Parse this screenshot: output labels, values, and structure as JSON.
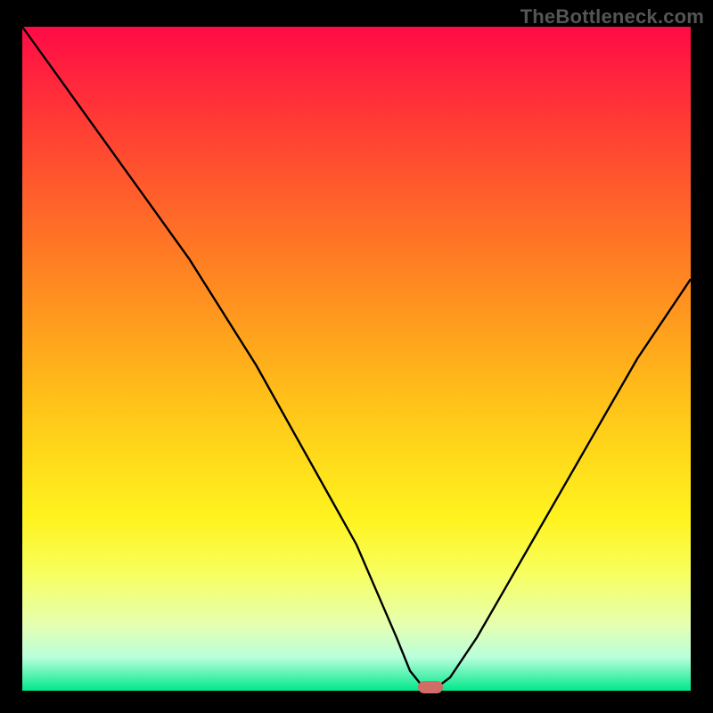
{
  "watermark": "TheBottleneck.com",
  "colors": {
    "frame": "#000000",
    "curve": "#000000",
    "marker": "#cf6d66",
    "gradient_top": "#ff0a46",
    "gradient_bottom": "#00e88a"
  },
  "chart_data": {
    "type": "line",
    "title": "",
    "xlabel": "",
    "ylabel": "",
    "xlim": [
      0,
      100
    ],
    "ylim": [
      0,
      100
    ],
    "grid": false,
    "series": [
      {
        "name": "bottleneck-curve",
        "x": [
          0,
          5,
          10,
          15,
          20,
          25,
          30,
          35,
          40,
          45,
          50,
          53,
          56,
          58,
          60,
          62,
          64,
          68,
          72,
          76,
          80,
          84,
          88,
          92,
          96,
          100
        ],
        "y": [
          100,
          93,
          86,
          79,
          72,
          65,
          57,
          49,
          40,
          31,
          22,
          15,
          8,
          3,
          0.5,
          0.5,
          2,
          8,
          15,
          22,
          29,
          36,
          43,
          50,
          56,
          62
        ]
      }
    ],
    "annotations": [
      {
        "name": "optimal-marker",
        "x": 61,
        "y": 0.5
      }
    ]
  }
}
